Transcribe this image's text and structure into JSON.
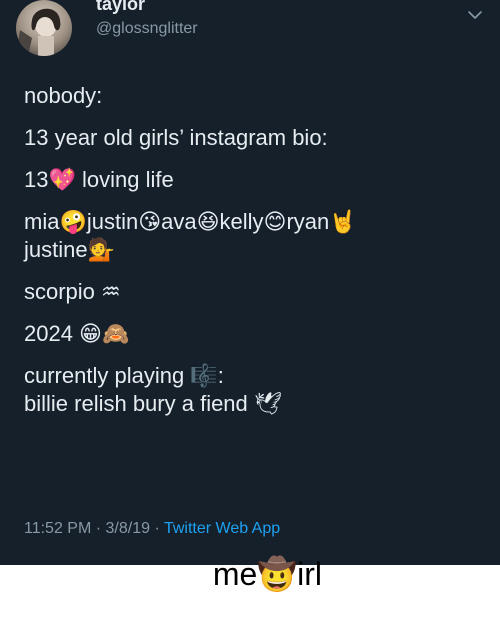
{
  "user": {
    "display_name": "taylor",
    "handle": "@glossnglitter"
  },
  "tweet": {
    "lines": [
      "nobody:",
      "13 year old girls’ instagram bio:",
      "13💖 loving life",
      "mia🤪justin😘ava😆kelly😊ryan🤘",
      "justine💁",
      "scorpio ♒",
      "2024 😁🙈",
      "currently playing 🎼:",
      "billie relish bury a fiend 🕊"
    ],
    "timestamp": "11:52 PM · 3/8/19 · ",
    "source": "Twitter Web App"
  },
  "caption": "me🤠irl",
  "colors": {
    "tweet_background": "#15202b",
    "text": "#e6ecf0",
    "secondary_text": "#8899a6",
    "link": "#1da1f2",
    "page_background": "#ffffff"
  },
  "icons": [
    "chevron-down-icon"
  ]
}
